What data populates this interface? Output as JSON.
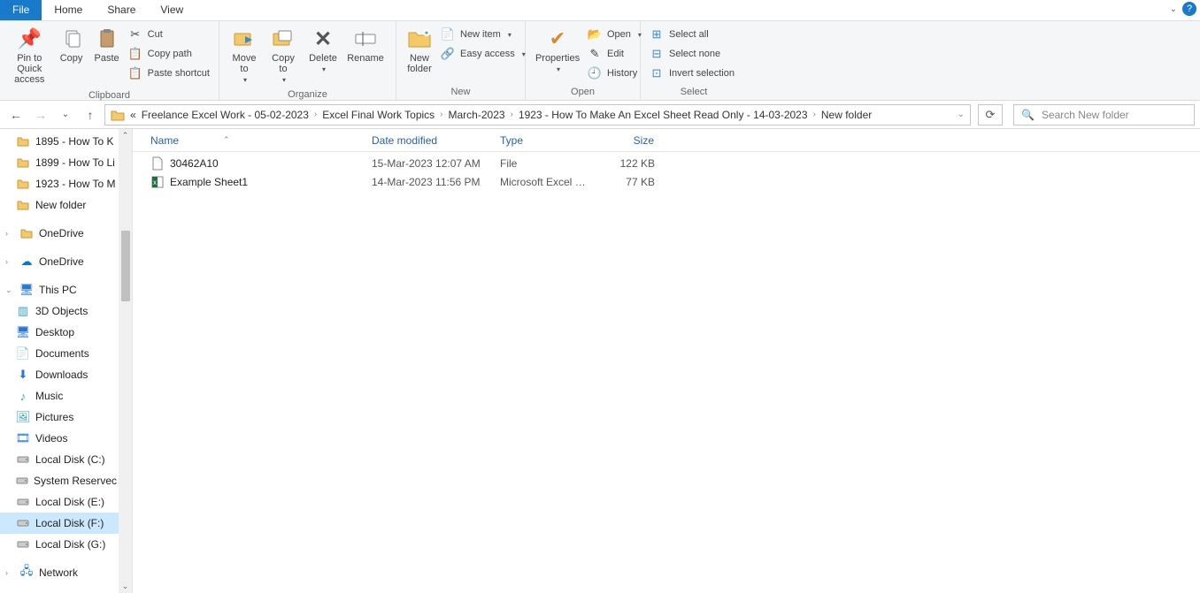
{
  "tabs": {
    "file": "File",
    "home": "Home",
    "share": "Share",
    "view": "View"
  },
  "ribbon": {
    "clipboard": {
      "label": "Clipboard",
      "pin": "Pin to Quick access",
      "copy": "Copy",
      "paste": "Paste",
      "cut": "Cut",
      "copypath": "Copy path",
      "pasteshortcut": "Paste shortcut"
    },
    "organize": {
      "label": "Organize",
      "moveto": "Move to",
      "copyto": "Copy to",
      "delete": "Delete",
      "rename": "Rename"
    },
    "new": {
      "label": "New",
      "newfolder": "New folder",
      "newitem": "New item",
      "easyaccess": "Easy access"
    },
    "open": {
      "label": "Open",
      "properties": "Properties",
      "open": "Open",
      "edit": "Edit",
      "history": "History"
    },
    "select": {
      "label": "Select",
      "selectall": "Select all",
      "selectnone": "Select none",
      "invert": "Invert selection"
    }
  },
  "breadcrumb": {
    "prefix": "«",
    "items": [
      "Freelance Excel Work - 05-02-2023",
      "Excel Final Work Topics",
      "March-2023",
      "1923 - How To Make An Excel Sheet Read Only - 14-03-2023",
      "New folder"
    ]
  },
  "search": {
    "placeholder": "Search New folder"
  },
  "sidebar": {
    "items": [
      {
        "label": "1895 - How To K",
        "icon": "folder"
      },
      {
        "label": "1899 - How To Li",
        "icon": "folder"
      },
      {
        "label": "1923 - How To M",
        "icon": "folder"
      },
      {
        "label": "New folder",
        "icon": "folder"
      }
    ],
    "onedrive1": "OneDrive",
    "onedrive2": "OneDrive",
    "thispc": "This PC",
    "pcitems": [
      {
        "label": "3D Objects",
        "icon": "3d"
      },
      {
        "label": "Desktop",
        "icon": "desktop"
      },
      {
        "label": "Documents",
        "icon": "docs"
      },
      {
        "label": "Downloads",
        "icon": "down"
      },
      {
        "label": "Music",
        "icon": "music"
      },
      {
        "label": "Pictures",
        "icon": "pics"
      },
      {
        "label": "Videos",
        "icon": "video"
      },
      {
        "label": "Local Disk (C:)",
        "icon": "disk"
      },
      {
        "label": "System Reservec",
        "icon": "disk"
      },
      {
        "label": "Local Disk (E:)",
        "icon": "disk"
      },
      {
        "label": "Local Disk (F:)",
        "icon": "disk",
        "selected": true
      },
      {
        "label": "Local Disk (G:)",
        "icon": "disk"
      }
    ],
    "network": "Network"
  },
  "columns": {
    "name": "Name",
    "date": "Date modified",
    "type": "Type",
    "size": "Size"
  },
  "files": [
    {
      "name": "30462A10",
      "date": "15-Mar-2023 12:07 AM",
      "type": "File",
      "size": "122 KB",
      "icon": "file"
    },
    {
      "name": "Example Sheet1",
      "date": "14-Mar-2023 11:56 PM",
      "type": "Microsoft Excel W...",
      "size": "77 KB",
      "icon": "excel"
    }
  ]
}
